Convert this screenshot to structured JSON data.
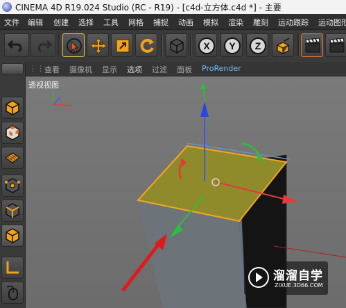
{
  "window": {
    "title": "CINEMA 4D R19.024 Studio (RC - R19) - [c4d-立方体.c4d *] - 主要"
  },
  "menubar": {
    "items": [
      "文件",
      "编辑",
      "创建",
      "选择",
      "工具",
      "网格",
      "捕捉",
      "动画",
      "模拟",
      "渲染",
      "雕刻",
      "运动跟踪",
      "运动图形"
    ]
  },
  "toolbar": {
    "undo_icon": "undo-icon",
    "redo_icon": "redo-icon",
    "tools": [
      "live-selection-icon",
      "move-icon",
      "scale-icon",
      "rotate-icon",
      "last-object-icon"
    ],
    "axis": [
      "X",
      "Y",
      "Z"
    ],
    "coord_icon": "coordinate-system-icon",
    "render_icons": [
      "render-view-icon",
      "render-picture-viewer-icon"
    ]
  },
  "viewport_menu": {
    "items": [
      "查看",
      "摄像机",
      "显示",
      "选项",
      "过滤",
      "面板",
      "ProRender"
    ]
  },
  "viewport": {
    "label": "透视视图"
  },
  "leftbar": {
    "icons": [
      "make-editable-icon",
      "checker-cube-icon",
      "texture-grid-icon",
      "points-mode-icon",
      "edges-mode-icon",
      "polygons-mode-icon",
      "axis-mode-icon",
      "mouse-tweak-icon"
    ]
  },
  "watermark": {
    "name": "溜溜自学",
    "url": "ZIXUE.3D66.COM"
  },
  "colors": {
    "selected_face": "#8f8a2a",
    "selection_outline": "#f5a623",
    "axis_x": "#e23b3b",
    "axis_y": "#3b5be6",
    "axis_z": "#2dbf3b",
    "menu_accent": "#6dc0ff"
  }
}
